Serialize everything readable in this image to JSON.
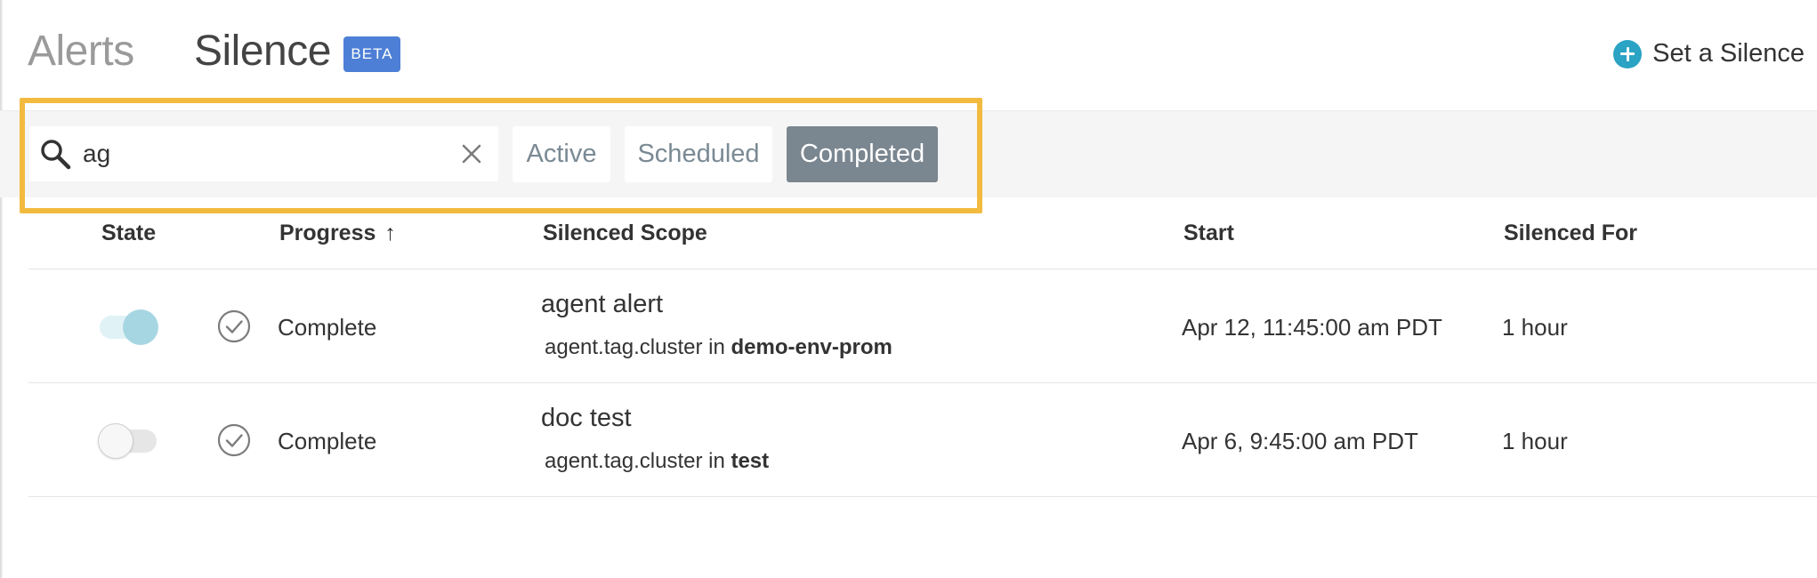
{
  "header": {
    "tab_alerts": "Alerts",
    "tab_silence": "Silence",
    "beta_badge": "BETA",
    "set_silence_label": "Set a Silence",
    "set_silence_icon": "plus-circle-icon"
  },
  "filters": {
    "search_value": "ag",
    "search_icon": "search-icon",
    "clear_icon": "close-icon",
    "buttons": [
      "Active",
      "Scheduled",
      "Completed"
    ],
    "selected": "Completed"
  },
  "table": {
    "columns": [
      "State",
      "Progress",
      "Silenced Scope",
      "Start",
      "Silenced For"
    ],
    "sort_indicator": "↑",
    "rows": [
      {
        "state_on": true,
        "progress": "Complete",
        "scope_name": "agent alert",
        "scope_key": "agent.tag.cluster in",
        "scope_value": "demo-env-prom",
        "start": "Apr 12, 11:45:00 am PDT",
        "silenced_for": "1 hour"
      },
      {
        "state_on": false,
        "progress": "Complete",
        "scope_name": "doc test",
        "scope_key": "agent.tag.cluster in",
        "scope_value": "test",
        "start": "Apr 6, 9:45:00 am PDT",
        "silenced_for": "1 hour"
      }
    ]
  },
  "colors": {
    "accent": "#2aa3c4",
    "beta": "#4d7fd6",
    "highlight": "#f2bb40",
    "selected_filter": "#7a8690"
  }
}
